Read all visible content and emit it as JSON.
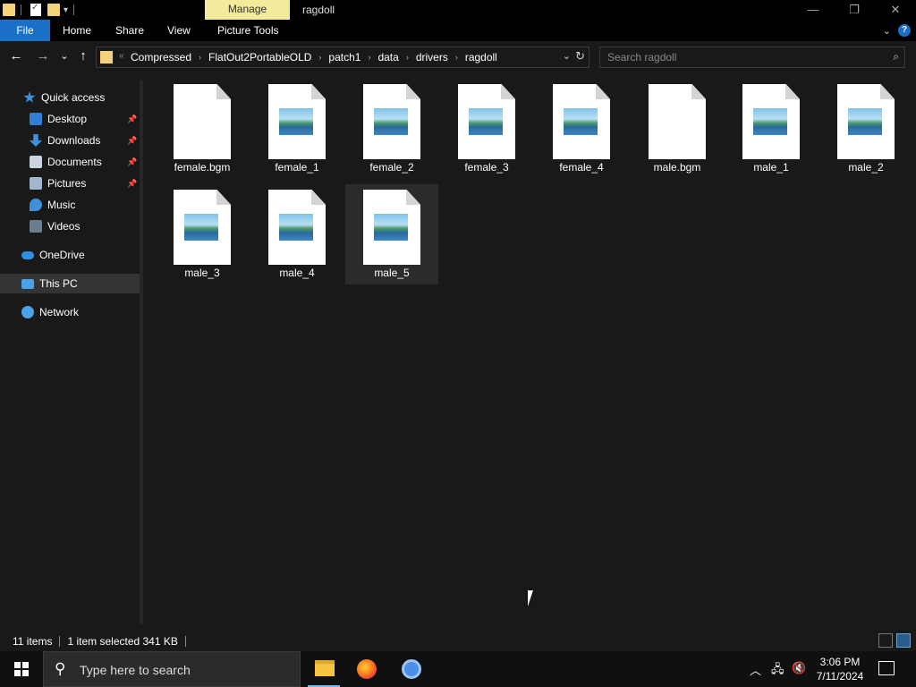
{
  "titlebar": {
    "manage_label": "Manage",
    "window_title": "ragdoll",
    "min_glyph": "—",
    "max_glyph": "❐",
    "close_glyph": "✕"
  },
  "ribbon": {
    "tabs": [
      "File",
      "Home",
      "Share",
      "View",
      "Picture Tools"
    ],
    "expand_glyph": "⌄",
    "help_glyph": "?"
  },
  "nav": {
    "back_glyph": "←",
    "forward_glyph": "→",
    "recent_glyph": "⌄",
    "up_glyph": "↑",
    "overflow_glyph": "«",
    "breadcrumbs": [
      "Compressed",
      "FlatOut2PortableOLD",
      "patch1",
      "data",
      "drivers",
      "ragdoll"
    ],
    "crumb_sep": "›",
    "dropdown_glyph": "⌄",
    "refresh_glyph": "↻"
  },
  "search": {
    "placeholder": "Search ragdoll",
    "icon_glyph": "⌕"
  },
  "sidebar": {
    "pin_glyph": "📌",
    "items": [
      {
        "label": "Quick access",
        "icon": "star-icon",
        "color": "#3f8fd9"
      },
      {
        "label": "Desktop",
        "icon": "desktop-icon",
        "color": "#2f7fd6"
      },
      {
        "label": "Downloads",
        "icon": "download-icon",
        "color": "#3f8fd9"
      },
      {
        "label": "Documents",
        "icon": "document-icon",
        "color": "#c9d4de"
      },
      {
        "label": "Pictures",
        "icon": "picture-icon",
        "color": "#9fb8cf"
      },
      {
        "label": "Music",
        "icon": "music-icon",
        "color": "#3f8fd9"
      },
      {
        "label": "Videos",
        "icon": "video-icon",
        "color": "#6b7d8e"
      },
      {
        "label": "OneDrive",
        "icon": "cloud-icon",
        "color": "#2f8fe6"
      },
      {
        "label": "This PC",
        "icon": "computer-icon",
        "color": "#4aa3e8"
      },
      {
        "label": "Network",
        "icon": "network-icon",
        "color": "#4aa3e8"
      }
    ]
  },
  "files": [
    {
      "name": "female.bgm",
      "image": false
    },
    {
      "name": "female_1",
      "image": true
    },
    {
      "name": "female_2",
      "image": true
    },
    {
      "name": "female_3",
      "image": true
    },
    {
      "name": "female_4",
      "image": true
    },
    {
      "name": "male.bgm",
      "image": false
    },
    {
      "name": "male_1",
      "image": true
    },
    {
      "name": "male_2",
      "image": true
    },
    {
      "name": "male_3",
      "image": true
    },
    {
      "name": "male_4",
      "image": true
    },
    {
      "name": "male_5",
      "image": true,
      "selected": true
    }
  ],
  "status": {
    "count": "11 items",
    "selection": "1 item selected  341 KB"
  },
  "taskbar": {
    "search_text": "Type here to search",
    "search_glyph": "⚲",
    "tray_chevron": "︿",
    "network_glyph": "🖧",
    "volume_glyph": "🔇",
    "time": "3:06 PM",
    "date": "7/11/2024"
  }
}
